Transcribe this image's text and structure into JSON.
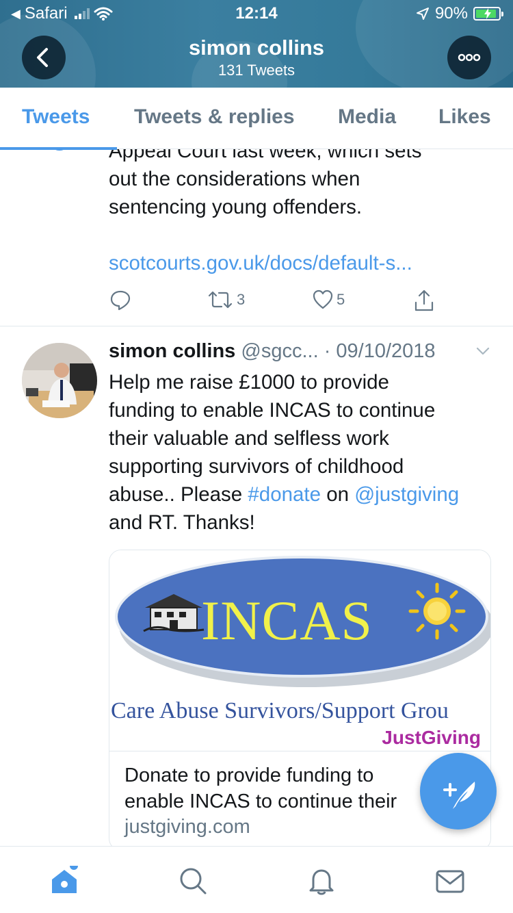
{
  "status_bar": {
    "back_app": "Safari",
    "time": "12:14",
    "battery_percent": "90%",
    "battery_level": 0.9,
    "signal_bars": 2
  },
  "header": {
    "title": "simon collins",
    "subtitle": "131 Tweets"
  },
  "tabs": [
    {
      "label": "Tweets",
      "active": true
    },
    {
      "label": "Tweets & replies",
      "active": false
    },
    {
      "label": "Media",
      "active": false
    },
    {
      "label": "Likes",
      "active": false
    }
  ],
  "tweet1": {
    "text_lines": [
      "Appeal Court last week, which sets",
      "out the considerations when",
      "sentencing young offenders."
    ],
    "link": "scotcourts.gov.uk/docs/default-s...",
    "retweets": "3",
    "likes": "5"
  },
  "tweet2": {
    "name": "simon collins",
    "handle": "@sgcc...",
    "date": "· 09/10/2018",
    "text": {
      "line1": "Help me raise £1000 to provide",
      "line2": "funding to enable INCAS to continue",
      "line3": "their valuable and selfless work",
      "line4": "supporting survivors of childhood",
      "line5_a": "abuse.. Please ",
      "hashtag": "#donate",
      "line5_b": " on ",
      "mention": "@justgiving",
      "line6": "and RT. Thanks!"
    },
    "card": {
      "logo_text": "INCAS",
      "caption": "Care Abuse Survivors/Support Grou",
      "brand": "JustGiving",
      "title_line1": "Donate to provide funding to",
      "title_line2": "enable INCAS to continue their",
      "domain": "justgiving.com"
    }
  },
  "colors": {
    "accent": "#4a99e9",
    "header_bg": "#357a9a",
    "secondary_text": "#657786",
    "justgiving": "#ab2ba0"
  },
  "icons": {
    "back": "chevron-left-icon",
    "more": "more-dots-icon",
    "reply": "reply-icon",
    "retweet": "retweet-icon",
    "like": "heart-icon",
    "share": "share-icon",
    "compose": "compose-tweet-icon",
    "home": "home-icon",
    "search": "search-icon",
    "notifications": "bell-icon",
    "messages": "mail-icon"
  }
}
